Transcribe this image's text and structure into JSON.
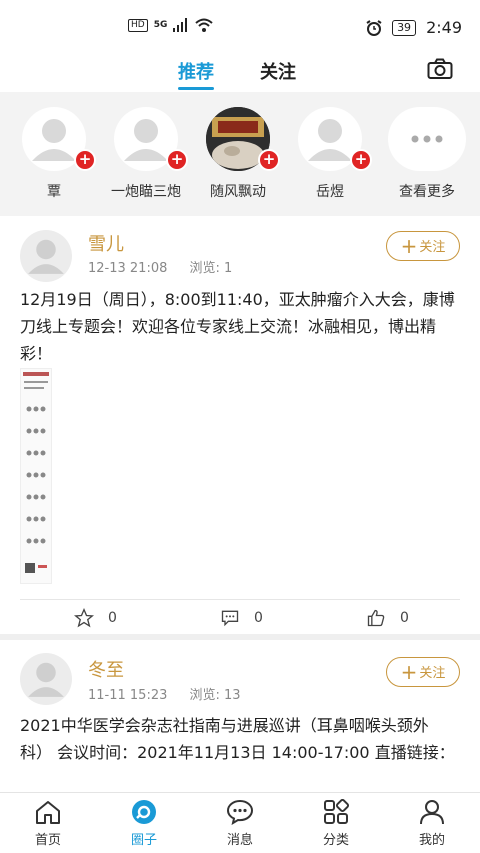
{
  "status_bar": {
    "network_badge": "HD",
    "signal_label": "5G",
    "battery": "39",
    "time": "2:49"
  },
  "top_tabs": [
    {
      "label": "推荐",
      "active": true
    },
    {
      "label": "关注",
      "active": false
    }
  ],
  "circles": [
    {
      "name": "覃",
      "avatar": "person-icon"
    },
    {
      "name": "一炮瞄三炮",
      "avatar": "person-icon"
    },
    {
      "name": "随风飘动",
      "avatar": "photo"
    },
    {
      "name": "岳煜",
      "avatar": "person-icon"
    },
    {
      "name": "查看更多",
      "avatar": "more-icon"
    }
  ],
  "posts": [
    {
      "author": "雪儿",
      "date": "12-13 21:08",
      "views": "浏览: 1",
      "follow_label": "关注",
      "text": "12月19日（周日），8:00到11:40，亚太肿瘤介入大会，康博刀线上专题会！欢迎各位专家线上交流！冰融相见，博出精彩！",
      "favorites": "0",
      "comments": "0",
      "likes": "0"
    },
    {
      "author": "冬至",
      "date": "11-11 15:23",
      "views": "浏览: 13",
      "follow_label": "关注",
      "text": "2021中华医学会杂志社指南与进展巡讲（耳鼻咽喉头颈外科） 会议时间：2021年11月13日 14:00-17:00 直播链接："
    }
  ],
  "bottom_nav": [
    {
      "label": "首页",
      "icon": "home-icon",
      "active": false
    },
    {
      "label": "圈子",
      "icon": "circle-icon",
      "active": true
    },
    {
      "label": "消息",
      "icon": "message-icon",
      "active": false
    },
    {
      "label": "分类",
      "icon": "category-icon",
      "active": false
    },
    {
      "label": "我的",
      "icon": "profile-icon",
      "active": false
    }
  ],
  "colors": {
    "accent": "#1a9ad6",
    "author": "#c8963e",
    "badge_red": "#e02424"
  }
}
